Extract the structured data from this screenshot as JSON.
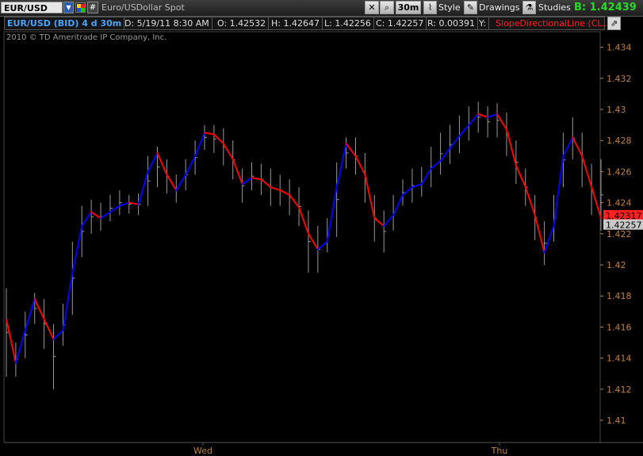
{
  "toolbar": {
    "symbol": "EUR/USD",
    "description": "Euro/USDollar Spot",
    "hash_label": "#",
    "aggregation": "30m",
    "style_label": "Style",
    "drawings_label": "Drawings",
    "studies_label": "Studies",
    "bid_label": "B: 1.42439"
  },
  "infobar": {
    "title": "EUR/USD (BID) 4 d 30m",
    "date": "D: 5/19/11 8:30 AM",
    "open": "O: 1.42532",
    "high": "H: 1.42647",
    "low": "L: 1.42256",
    "close": "C: 1.42257",
    "range": "R: 0.00391",
    "y": "Y:",
    "study": "SlopeDirectionalLine (CL..."
  },
  "copyright": "2010 © TD Ameritrade IP Company, Inc.",
  "colors": {
    "up": "#0000ff",
    "down": "#ff0000",
    "bars": "#9a9a9a",
    "axis": "#c08040"
  },
  "chart_data": {
    "type": "line",
    "yticks": [
      "1.434",
      "1.432",
      "1.43",
      "1.428",
      "1.426",
      "1.424",
      "1.422",
      "1.42",
      "1.418",
      "1.416",
      "1.414",
      "1.412",
      "1.41"
    ],
    "xticks": [
      "Wed",
      "Thu"
    ],
    "ylim": [
      1.41,
      1.434
    ],
    "price_labels": [
      "1.42317",
      "1.42257"
    ],
    "series": [
      {
        "name": "SlopeDirectionalLine",
        "values": [
          1.4165,
          1.4137,
          1.4158,
          1.4178,
          1.4165,
          1.4152,
          1.4158,
          1.4195,
          1.4225,
          1.4234,
          1.423,
          1.4234,
          1.4238,
          1.424,
          1.4239,
          1.426,
          1.4272,
          1.4258,
          1.4248,
          1.4258,
          1.427,
          1.4285,
          1.4284,
          1.4278,
          1.4268,
          1.4252,
          1.4256,
          1.4255,
          1.425,
          1.4248,
          1.4245,
          1.4237,
          1.422,
          1.421,
          1.4215,
          1.425,
          1.4278,
          1.427,
          1.4258,
          1.423,
          1.4225,
          1.4232,
          1.4245,
          1.425,
          1.4252,
          1.4262,
          1.4267,
          1.4275,
          1.4283,
          1.429,
          1.4297,
          1.4295,
          1.4297,
          1.4287,
          1.4264,
          1.425,
          1.4232,
          1.4208,
          1.4225,
          1.427,
          1.4282,
          1.427,
          1.425,
          1.423
        ]
      }
    ],
    "ohlc": [
      [
        1.4185,
        1.4128
      ],
      [
        1.415,
        1.4128
      ],
      [
        1.417,
        1.414
      ],
      [
        1.4182,
        1.4162
      ],
      [
        1.4178,
        1.4146
      ],
      [
        1.4162,
        1.412
      ],
      [
        1.4175,
        1.4148
      ],
      [
        1.4215,
        1.4168
      ],
      [
        1.4238,
        1.4205
      ],
      [
        1.4242,
        1.422
      ],
      [
        1.424,
        1.4222
      ],
      [
        1.4245,
        1.4228
      ],
      [
        1.4248,
        1.4232
      ],
      [
        1.4245,
        1.4233
      ],
      [
        1.4246,
        1.4232
      ],
      [
        1.427,
        1.4238
      ],
      [
        1.4276,
        1.425
      ],
      [
        1.4268,
        1.4246
      ],
      [
        1.4258,
        1.424
      ],
      [
        1.4268,
        1.4248
      ],
      [
        1.428,
        1.4258
      ],
      [
        1.429,
        1.4274
      ],
      [
        1.429,
        1.4272
      ],
      [
        1.4288,
        1.4264
      ],
      [
        1.428,
        1.4255
      ],
      [
        1.4262,
        1.424
      ],
      [
        1.4266,
        1.4248
      ],
      [
        1.4265,
        1.4245
      ],
      [
        1.4262,
        1.4238
      ],
      [
        1.4258,
        1.4238
      ],
      [
        1.4255,
        1.4232
      ],
      [
        1.425,
        1.4225
      ],
      [
        1.4235,
        1.4195
      ],
      [
        1.4225,
        1.4195
      ],
      [
        1.423,
        1.4208
      ],
      [
        1.4266,
        1.4218
      ],
      [
        1.4282,
        1.4262
      ],
      [
        1.4282,
        1.4258
      ],
      [
        1.4272,
        1.424
      ],
      [
        1.4245,
        1.4215
      ],
      [
        1.4235,
        1.4208
      ],
      [
        1.4245,
        1.4222
      ],
      [
        1.4255,
        1.4238
      ],
      [
        1.4262,
        1.424
      ],
      [
        1.4263,
        1.4244
      ],
      [
        1.4276,
        1.425
      ],
      [
        1.4285,
        1.4258
      ],
      [
        1.429,
        1.4265
      ],
      [
        1.4296,
        1.4272
      ],
      [
        1.4302,
        1.428
      ],
      [
        1.4305,
        1.4285
      ],
      [
        1.4302,
        1.4282
      ],
      [
        1.4304,
        1.4282
      ],
      [
        1.4298,
        1.427
      ],
      [
        1.428,
        1.4252
      ],
      [
        1.4262,
        1.4238
      ],
      [
        1.4245,
        1.4216
      ],
      [
        1.4228,
        1.42
      ],
      [
        1.4245,
        1.4215
      ],
      [
        1.4285,
        1.425
      ],
      [
        1.4295,
        1.4268
      ],
      [
        1.4285,
        1.425
      ],
      [
        1.4265,
        1.4232
      ],
      [
        1.4268,
        1.4222
      ]
    ]
  }
}
